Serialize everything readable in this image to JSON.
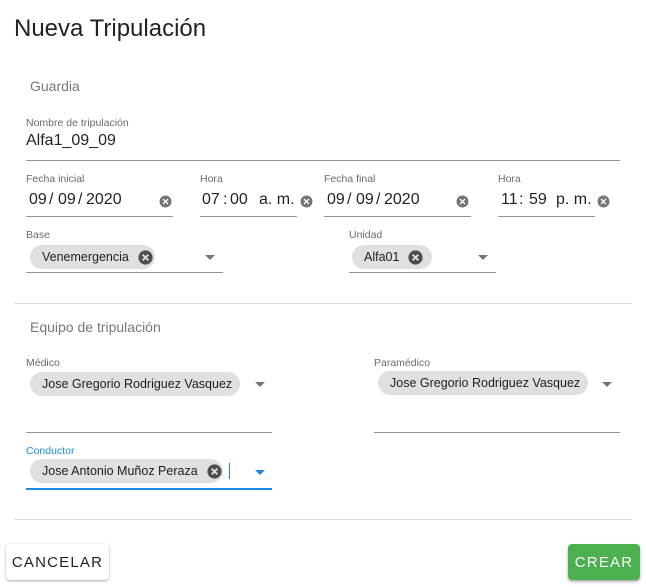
{
  "dialog": {
    "title": "Nueva Tripulación"
  },
  "guardia": {
    "section_label": "Guardia",
    "nombre": {
      "label": "Nombre de tripulación",
      "value": "Alfa1_09_09"
    },
    "fecha_inicial": {
      "label": "Fecha inicial",
      "day": "09",
      "month": "09",
      "year": "2020",
      "sep": "/"
    },
    "hora_inicial": {
      "label": "Hora",
      "hour": "07",
      "minute": "00",
      "period": "a. m.",
      "sep": ":"
    },
    "fecha_final": {
      "label": "Fecha final",
      "day": "09",
      "month": "09",
      "year": "2020",
      "sep": "/"
    },
    "hora_final": {
      "label": "Hora",
      "hour": "11",
      "minute": "59",
      "period": "p. m.",
      "sep": ":"
    },
    "base": {
      "label": "Base",
      "chip": "Venemergencia"
    },
    "unidad": {
      "label": "Unidad",
      "chip": "Alfa01"
    }
  },
  "equipo": {
    "section_label": "Equipo de tripulación",
    "medico": {
      "label": "Médico",
      "chip": "Jose Gregorio Rodriguez Vasquez"
    },
    "paramedico": {
      "label": "Paramédico",
      "chip": "Jose Gregorio Rodriguez Vasquez"
    },
    "conductor": {
      "label": "Conductor",
      "chip": "Jose Antonio Muñoz Peraza"
    }
  },
  "actions": {
    "cancel_label": "CANCELAR",
    "create_label": "CREAR"
  },
  "colors": {
    "focus": "#1e88e5",
    "create_button": "#4caf50",
    "chip": "#e0e0e0"
  },
  "icons": {
    "clear": "clear-circle-icon",
    "chip_delete": "chip-delete-icon",
    "dropdown": "dropdown-arrow-icon"
  }
}
